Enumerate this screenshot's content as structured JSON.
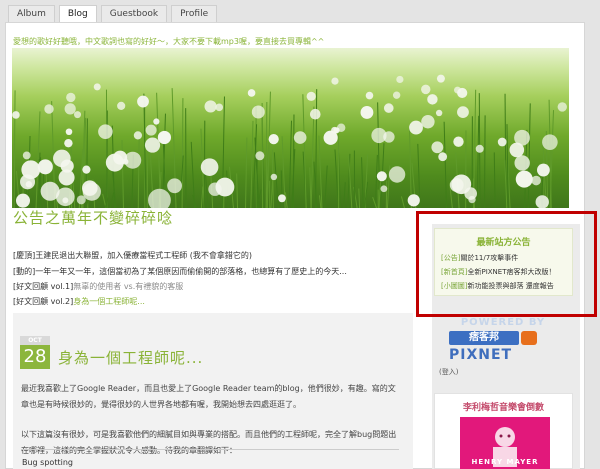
{
  "tabs": [
    "Album",
    "Blog",
    "Guestbook",
    "Profile"
  ],
  "active_tab": "Blog",
  "tagline": "愛想的歌好好聽哦，中文歌詞也寫的好好～，大家不要下載mp3喔，要直接去買專輯^^",
  "announcement": {
    "title": "公告之萬年不變碎碎唸",
    "lines": [
      {
        "tag": "[慶頂]",
        "text": "王建民退出大聯盟，加入優療當程式工程師 (我不會拿錯它的)",
        "style": "normal"
      },
      {
        "tag": "[動的]",
        "text": "一年一年又一年，這個當初為了某個原因而偷偷開的部落格，也總算有了歷史上的今天...",
        "style": "normal"
      },
      {
        "tag": "[好文回顧 vol.1]",
        "text": "無辜的使用者 vs.有禮貌的客服",
        "style": "grey"
      },
      {
        "tag": "[好文回顧 vol.2]",
        "text": "身為一個工程師呢...",
        "style": "link"
      }
    ]
  },
  "post": {
    "month": "OCT",
    "day": "28",
    "title": "身為一個工程師呢...",
    "paragraph1": "最近我喜歡上了Google Reader，而且也愛上了Google Reader team的blog，他們很妙，有趣。寫的文章也是有時候很妙的，覺得很妙的人世界各地都有喔，我開始想去四處逛逛了。",
    "paragraph2": "以下這篇沒有很妙，可是我喜歡他們的細膩目如與專業的搭配。而且他們的工程師呢，完全了解bug問題出在哪裡，這樣的完全掌握狀況令人感動。待我的章翻譯如下：",
    "section_heading": "Bug spotting"
  },
  "sidebar": {
    "news_title": "最新站方公告",
    "news_items": [
      {
        "tag": "[公告]",
        "text": "關於11/7攻擊事件"
      },
      {
        "tag": "[新首頁]",
        "text": "全新PIXNET痞客邦大改版！"
      },
      {
        "tag": "[小圖圖]",
        "text": "新功能投票與部落 還度報告"
      }
    ],
    "powered_by": "POWERED BY",
    "pixnet_cn": "痞客邦",
    "pixnet_en": "PIXNET",
    "login_link": "(登入)",
    "concert_title": "李利梅哲音樂會倒數",
    "concert_name": "HENRY MAYER"
  },
  "colors": {
    "accent_green": "#8ab337",
    "highlight_red": "#c00000",
    "pixnet_blue": "#3f6ebd",
    "concert_pink": "#e2187b"
  }
}
